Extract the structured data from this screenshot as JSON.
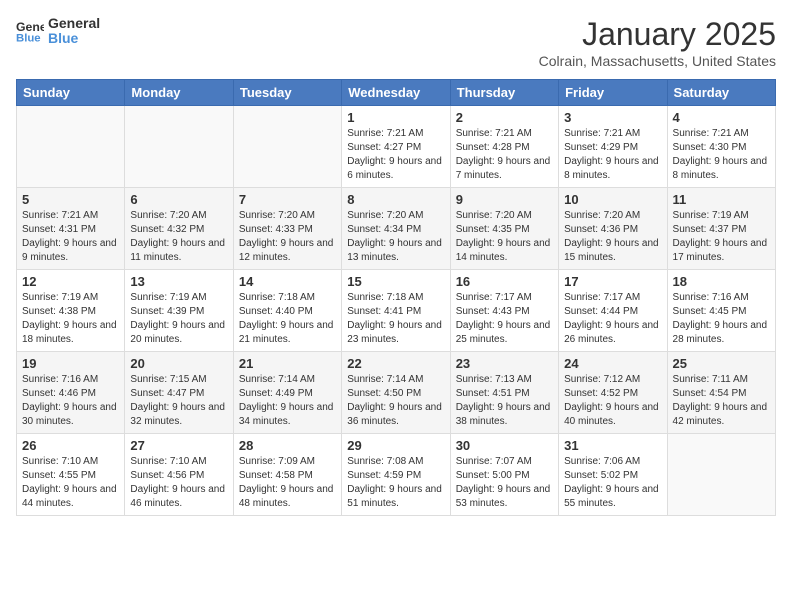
{
  "logo": {
    "text1": "General",
    "text2": "Blue"
  },
  "title": "January 2025",
  "location": "Colrain, Massachusetts, United States",
  "days_of_week": [
    "Sunday",
    "Monday",
    "Tuesday",
    "Wednesday",
    "Thursday",
    "Friday",
    "Saturday"
  ],
  "weeks": [
    [
      {
        "day": "",
        "sunrise": "",
        "sunset": "",
        "daylight": ""
      },
      {
        "day": "",
        "sunrise": "",
        "sunset": "",
        "daylight": ""
      },
      {
        "day": "",
        "sunrise": "",
        "sunset": "",
        "daylight": ""
      },
      {
        "day": "1",
        "sunrise": "Sunrise: 7:21 AM",
        "sunset": "Sunset: 4:27 PM",
        "daylight": "Daylight: 9 hours and 6 minutes."
      },
      {
        "day": "2",
        "sunrise": "Sunrise: 7:21 AM",
        "sunset": "Sunset: 4:28 PM",
        "daylight": "Daylight: 9 hours and 7 minutes."
      },
      {
        "day": "3",
        "sunrise": "Sunrise: 7:21 AM",
        "sunset": "Sunset: 4:29 PM",
        "daylight": "Daylight: 9 hours and 8 minutes."
      },
      {
        "day": "4",
        "sunrise": "Sunrise: 7:21 AM",
        "sunset": "Sunset: 4:30 PM",
        "daylight": "Daylight: 9 hours and 8 minutes."
      }
    ],
    [
      {
        "day": "5",
        "sunrise": "Sunrise: 7:21 AM",
        "sunset": "Sunset: 4:31 PM",
        "daylight": "Daylight: 9 hours and 9 minutes."
      },
      {
        "day": "6",
        "sunrise": "Sunrise: 7:20 AM",
        "sunset": "Sunset: 4:32 PM",
        "daylight": "Daylight: 9 hours and 11 minutes."
      },
      {
        "day": "7",
        "sunrise": "Sunrise: 7:20 AM",
        "sunset": "Sunset: 4:33 PM",
        "daylight": "Daylight: 9 hours and 12 minutes."
      },
      {
        "day": "8",
        "sunrise": "Sunrise: 7:20 AM",
        "sunset": "Sunset: 4:34 PM",
        "daylight": "Daylight: 9 hours and 13 minutes."
      },
      {
        "day": "9",
        "sunrise": "Sunrise: 7:20 AM",
        "sunset": "Sunset: 4:35 PM",
        "daylight": "Daylight: 9 hours and 14 minutes."
      },
      {
        "day": "10",
        "sunrise": "Sunrise: 7:20 AM",
        "sunset": "Sunset: 4:36 PM",
        "daylight": "Daylight: 9 hours and 15 minutes."
      },
      {
        "day": "11",
        "sunrise": "Sunrise: 7:19 AM",
        "sunset": "Sunset: 4:37 PM",
        "daylight": "Daylight: 9 hours and 17 minutes."
      }
    ],
    [
      {
        "day": "12",
        "sunrise": "Sunrise: 7:19 AM",
        "sunset": "Sunset: 4:38 PM",
        "daylight": "Daylight: 9 hours and 18 minutes."
      },
      {
        "day": "13",
        "sunrise": "Sunrise: 7:19 AM",
        "sunset": "Sunset: 4:39 PM",
        "daylight": "Daylight: 9 hours and 20 minutes."
      },
      {
        "day": "14",
        "sunrise": "Sunrise: 7:18 AM",
        "sunset": "Sunset: 4:40 PM",
        "daylight": "Daylight: 9 hours and 21 minutes."
      },
      {
        "day": "15",
        "sunrise": "Sunrise: 7:18 AM",
        "sunset": "Sunset: 4:41 PM",
        "daylight": "Daylight: 9 hours and 23 minutes."
      },
      {
        "day": "16",
        "sunrise": "Sunrise: 7:17 AM",
        "sunset": "Sunset: 4:43 PM",
        "daylight": "Daylight: 9 hours and 25 minutes."
      },
      {
        "day": "17",
        "sunrise": "Sunrise: 7:17 AM",
        "sunset": "Sunset: 4:44 PM",
        "daylight": "Daylight: 9 hours and 26 minutes."
      },
      {
        "day": "18",
        "sunrise": "Sunrise: 7:16 AM",
        "sunset": "Sunset: 4:45 PM",
        "daylight": "Daylight: 9 hours and 28 minutes."
      }
    ],
    [
      {
        "day": "19",
        "sunrise": "Sunrise: 7:16 AM",
        "sunset": "Sunset: 4:46 PM",
        "daylight": "Daylight: 9 hours and 30 minutes."
      },
      {
        "day": "20",
        "sunrise": "Sunrise: 7:15 AM",
        "sunset": "Sunset: 4:47 PM",
        "daylight": "Daylight: 9 hours and 32 minutes."
      },
      {
        "day": "21",
        "sunrise": "Sunrise: 7:14 AM",
        "sunset": "Sunset: 4:49 PM",
        "daylight": "Daylight: 9 hours and 34 minutes."
      },
      {
        "day": "22",
        "sunrise": "Sunrise: 7:14 AM",
        "sunset": "Sunset: 4:50 PM",
        "daylight": "Daylight: 9 hours and 36 minutes."
      },
      {
        "day": "23",
        "sunrise": "Sunrise: 7:13 AM",
        "sunset": "Sunset: 4:51 PM",
        "daylight": "Daylight: 9 hours and 38 minutes."
      },
      {
        "day": "24",
        "sunrise": "Sunrise: 7:12 AM",
        "sunset": "Sunset: 4:52 PM",
        "daylight": "Daylight: 9 hours and 40 minutes."
      },
      {
        "day": "25",
        "sunrise": "Sunrise: 7:11 AM",
        "sunset": "Sunset: 4:54 PM",
        "daylight": "Daylight: 9 hours and 42 minutes."
      }
    ],
    [
      {
        "day": "26",
        "sunrise": "Sunrise: 7:10 AM",
        "sunset": "Sunset: 4:55 PM",
        "daylight": "Daylight: 9 hours and 44 minutes."
      },
      {
        "day": "27",
        "sunrise": "Sunrise: 7:10 AM",
        "sunset": "Sunset: 4:56 PM",
        "daylight": "Daylight: 9 hours and 46 minutes."
      },
      {
        "day": "28",
        "sunrise": "Sunrise: 7:09 AM",
        "sunset": "Sunset: 4:58 PM",
        "daylight": "Daylight: 9 hours and 48 minutes."
      },
      {
        "day": "29",
        "sunrise": "Sunrise: 7:08 AM",
        "sunset": "Sunset: 4:59 PM",
        "daylight": "Daylight: 9 hours and 51 minutes."
      },
      {
        "day": "30",
        "sunrise": "Sunrise: 7:07 AM",
        "sunset": "Sunset: 5:00 PM",
        "daylight": "Daylight: 9 hours and 53 minutes."
      },
      {
        "day": "31",
        "sunrise": "Sunrise: 7:06 AM",
        "sunset": "Sunset: 5:02 PM",
        "daylight": "Daylight: 9 hours and 55 minutes."
      },
      {
        "day": "",
        "sunrise": "",
        "sunset": "",
        "daylight": ""
      }
    ]
  ]
}
